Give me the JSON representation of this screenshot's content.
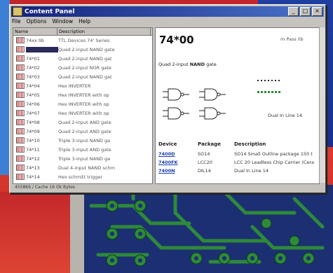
{
  "window": {
    "title": "Content Panel",
    "controls": [
      "_",
      "□",
      "×"
    ]
  },
  "menu": [
    "File",
    "Options",
    "Window",
    "Help"
  ],
  "list": {
    "headers": [
      "Name",
      "Description"
    ],
    "rows": [
      {
        "name": "74xx lib",
        "desc": "TTL Devices 74' Series"
      },
      {
        "name": "",
        "desc": "Quad 2-input NAND gate"
      },
      {
        "name": "74*01",
        "desc": "Quad 2-input NAND gat"
      },
      {
        "name": "74*02",
        "desc": "Quad 2-input NOR gate"
      },
      {
        "name": "74*03",
        "desc": "Quad 2-input NAND gat"
      },
      {
        "name": "74*04",
        "desc": "Hex INVERTER"
      },
      {
        "name": "74*05",
        "desc": "Hex INVERTER with op"
      },
      {
        "name": "74*06",
        "desc": "Hex INVERTER with op"
      },
      {
        "name": "74*07",
        "desc": "Hex INVERTER with op"
      },
      {
        "name": "74*08",
        "desc": "Quad 2-input AND gate"
      },
      {
        "name": "74*09",
        "desc": "Quad 2-input AND gate"
      },
      {
        "name": "74*10",
        "desc": "Triple 3-input NAND ga"
      },
      {
        "name": "74*11",
        "desc": "Triple 3-input AND gate"
      },
      {
        "name": "74*12",
        "desc": "Triple 3-input NAND ga"
      },
      {
        "name": "74*13",
        "desc": "Dual 4-input NAND schm"
      },
      {
        "name": "74*14",
        "desc": "Hex schmitt trigger"
      }
    ]
  },
  "status": "4558Kb / Cache 16 Ok Bytes",
  "detail": {
    "title": "74*00",
    "logo": "m Pass lib",
    "description_pre": "Quad 2-input ",
    "description_bold": "NAND",
    "description_post": " gate",
    "package_label": "Dual In Line 14",
    "table": {
      "headers": [
        "Device",
        "Package",
        "Description"
      ],
      "rows": [
        {
          "device": "7400D",
          "package": "SO14",
          "desc": "SO14 Small Outline package 150 t"
        },
        {
          "device": "7400FK",
          "package": "LCC20",
          "desc": "LCC 20 Leadless Chip Carrier (Cera"
        },
        {
          "device": "7400N",
          "package": "DIL14",
          "desc": "Dual In Line 14"
        }
      ]
    }
  },
  "colors": {
    "accent": "#1a3cb0",
    "selection": "#2a2a5a",
    "titlebar": "#13217c",
    "pcb_trace": "#2e8a3a"
  }
}
